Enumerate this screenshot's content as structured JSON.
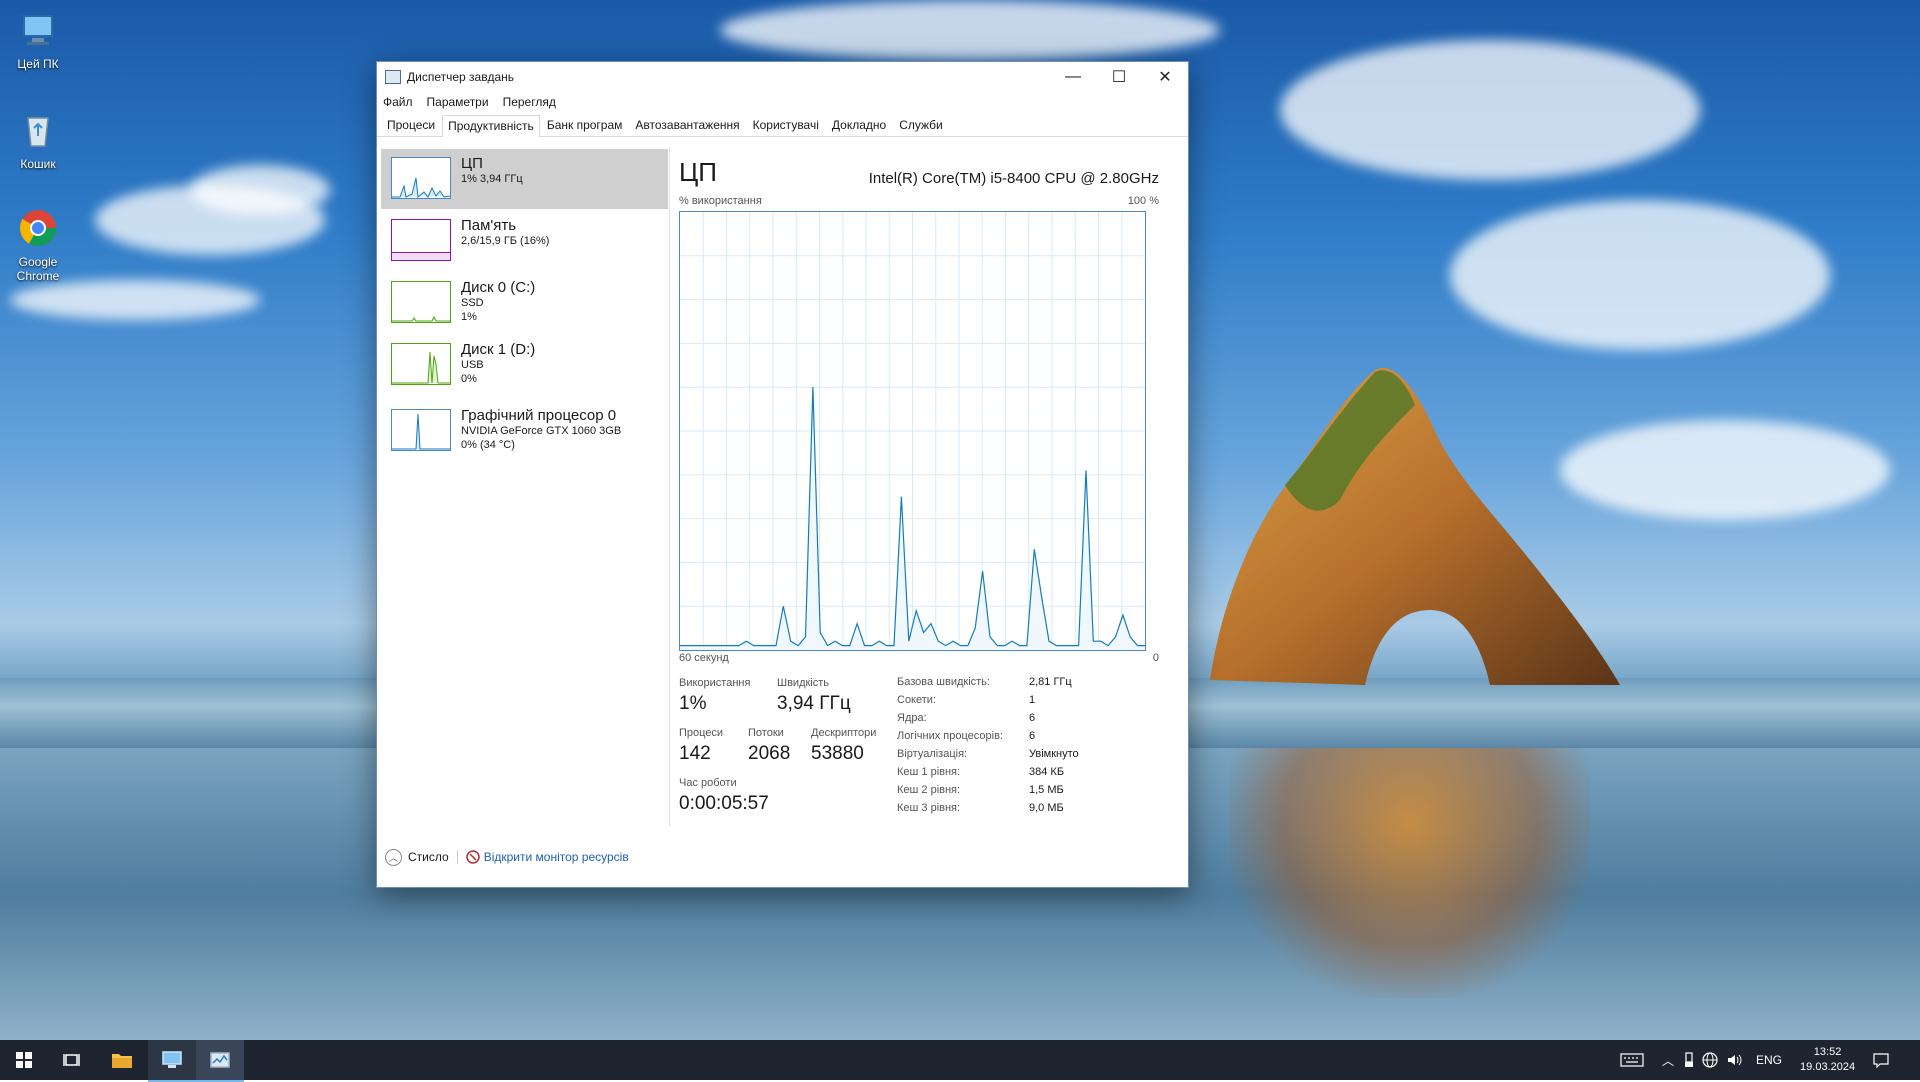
{
  "desktop": {
    "icons": [
      {
        "label": "Цей ПК",
        "icon": "computer-icon"
      },
      {
        "label": "Кошик",
        "icon": "recycle-bin-icon"
      },
      {
        "label": "Google Chrome",
        "icon": "chrome-icon"
      }
    ]
  },
  "window": {
    "title": "Диспетчер завдань",
    "controls": {
      "minimize": "—",
      "maximize": "☐",
      "close": "✕"
    },
    "menu": [
      "Файл",
      "Параметри",
      "Перегляд"
    ],
    "tabs": [
      "Процеси",
      "Продуктивність",
      "Банк програм",
      "Автозавантаження",
      "Користувачі",
      "Докладно",
      "Служби"
    ],
    "active_tab": "Продуктивність"
  },
  "sidebar": {
    "items": [
      {
        "name": "ЦП",
        "line1": "1% 3,94 ГГц",
        "line2": "",
        "line3": "",
        "color": "#117dbb"
      },
      {
        "name": "Пам'ять",
        "line1": "2,6/15,9 ГБ (16%)",
        "line2": "",
        "line3": "",
        "color": "#8b12ae"
      },
      {
        "name": "Диск 0 (C:)",
        "line1": "SSD",
        "line2": "1%",
        "line3": "",
        "color": "#4da60c"
      },
      {
        "name": "Диск 1 (D:)",
        "line1": "USB",
        "line2": "0%",
        "line3": "",
        "color": "#4da60c"
      },
      {
        "name": "Графічний процесор 0",
        "line1": "NVIDIA GeForce GTX 1060 3GB",
        "line2": "0% (34 °C)",
        "line3": "",
        "color": "#117dbb"
      }
    ]
  },
  "cpu": {
    "title": "ЦП",
    "model": "Intel(R) Core(TM) i5-8400 CPU @ 2.80GHz",
    "graph_top_left": "% використання",
    "graph_top_right": "100 %",
    "graph_bottom_left": "60 секунд",
    "graph_bottom_right": "0",
    "usage_label": "Використання",
    "usage_value": "1%",
    "speed_label": "Швидкість",
    "speed_value": "3,94 ГГц",
    "processes_label": "Процеси",
    "processes_value": "142",
    "threads_label": "Потоки",
    "threads_value": "2068",
    "handles_label": "Дескриптори",
    "handles_value": "53880",
    "uptime_label": "Час роботи",
    "uptime_value": "0:00:05:57",
    "details": [
      {
        "k": "Базова швидкість:",
        "v": "2,81 ГГц"
      },
      {
        "k": "Сокети:",
        "v": "1"
      },
      {
        "k": "Ядра:",
        "v": "6"
      },
      {
        "k": "Логічних процесорів:",
        "v": "6"
      },
      {
        "k": "Віртуалізація:",
        "v": "Увімкнуто"
      },
      {
        "k": "Кеш 1 рівня:",
        "v": "384 КБ"
      },
      {
        "k": "Кеш 2 рівня:",
        "v": "1,5 МБ"
      },
      {
        "k": "Кеш 3 рівня:",
        "v": "9,0 МБ"
      }
    ],
    "graph_series": [
      1,
      1,
      1,
      1,
      1,
      1,
      1,
      1,
      1,
      2,
      1,
      1,
      1,
      1,
      10,
      2,
      1,
      3,
      60,
      4,
      1,
      2,
      1,
      1,
      6,
      1,
      1,
      2,
      1,
      1,
      35,
      2,
      9,
      4,
      6,
      2,
      1,
      2,
      1,
      1,
      5,
      18,
      3,
      1,
      1,
      2,
      1,
      1,
      23,
      12,
      2,
      1,
      1,
      1,
      1,
      41,
      2,
      2,
      1,
      3,
      8,
      3,
      1,
      1
    ]
  },
  "bottom": {
    "fewer_details": "Стисло",
    "open_monitor": "Відкрити монітор ресурсів"
  },
  "taskbar": {
    "language": "ENG",
    "time": "13:52",
    "date": "19.03.2024"
  }
}
